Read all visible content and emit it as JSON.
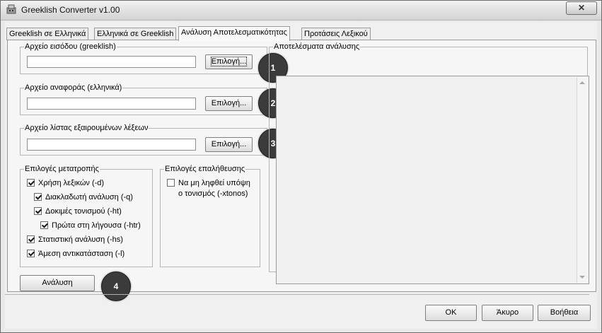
{
  "window": {
    "title": "Greeklish Converter v1.00",
    "close_glyph": "✕"
  },
  "tabs": [
    {
      "label": "Greeklish σε Ελληνικά",
      "active": false
    },
    {
      "label": "Ελληνικά σε Greeklish",
      "active": false
    },
    {
      "label": "Ανάλυση Αποτελεσματικότητας",
      "active": true
    },
    {
      "label": "Προτάσεις Λεξικού",
      "active": false
    }
  ],
  "input_file": {
    "legend": "Αρχείο εισόδου (greeklish)",
    "value": "",
    "button": "Επιλογή...",
    "badge": "1"
  },
  "reference_file": {
    "legend": "Αρχείο αναφοράς (ελληνικά)",
    "value": "",
    "button": "Επιλογή...",
    "badge": "2"
  },
  "exclusion_file": {
    "legend": "Αρχείο λίστας εξαιρουμένων λέξεων",
    "value": "",
    "button": "Επιλογή...",
    "badge": "3"
  },
  "conversion_options": {
    "legend": "Επιλογές μετατροπής",
    "items": [
      {
        "label": "Χρήση λεξικών (-d)",
        "checked": true
      },
      {
        "label": "Διακλαδωτή ανάλυση (-q)",
        "checked": true
      },
      {
        "label": "Δοκιμές τονισμού (-ht)",
        "checked": true
      },
      {
        "label": "Πρώτα στη λήγουσα (-htr)",
        "checked": true
      },
      {
        "label": "Στατιστική ανάλυση (-hs)",
        "checked": true
      },
      {
        "label": "Άμεση αντικατάσταση (-l)",
        "checked": true
      }
    ]
  },
  "verification_options": {
    "legend": "Επιλογές επαλήθευσης",
    "items": [
      {
        "label_line1": "Να μη ληφθεί υπόψη",
        "label_line2": "ο τονισμός (-xtonos)",
        "checked": false
      }
    ]
  },
  "results": {
    "legend": "Αποτελέσματα ανάλυσης",
    "text": ""
  },
  "analyze": {
    "button": "Ανάλυση",
    "badge": "4"
  },
  "dialog_buttons": {
    "ok": "OK",
    "cancel": "Άκυρο",
    "help": "Βοήθεια"
  },
  "icons": {
    "app": "converter-app-icon",
    "close": "close-icon",
    "scroll_up": "scroll-up-arrow-icon",
    "scroll_down": "scroll-down-arrow-icon",
    "check": "checkmark-icon"
  }
}
